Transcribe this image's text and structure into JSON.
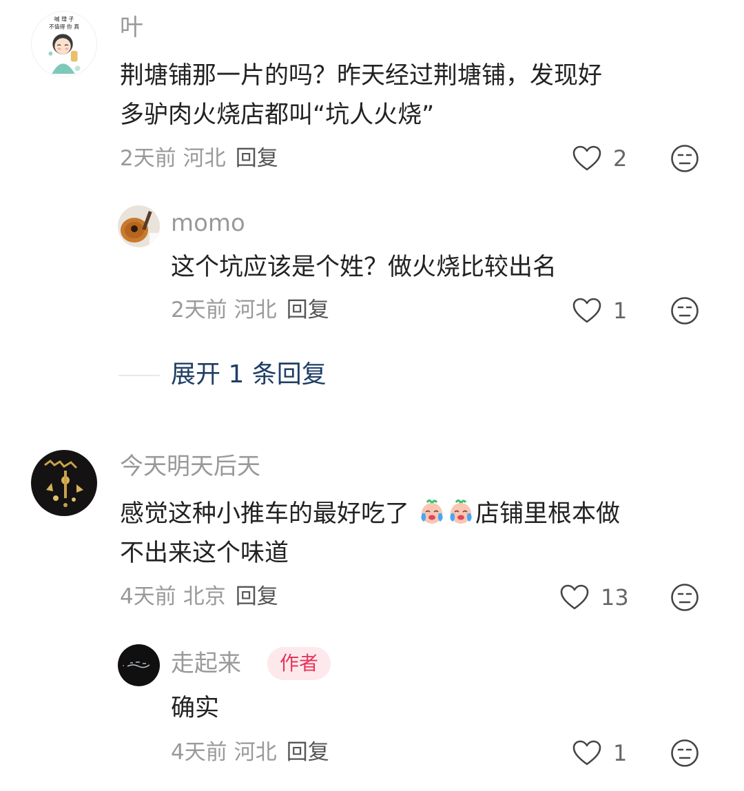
{
  "comments": [
    {
      "username": "叶",
      "avatar_icon": "cartoon-girl-avatar",
      "avatar_text": "...喊 理 不值得 你 真",
      "text": "荆塘铺那一片的吗？昨天经过荆塘铺，发现好多驴肉火烧店都叫“坑人火烧”",
      "text_lines": [
        "荆塘铺那一片的吗？昨天经过荆塘铺，发现好",
        "多驴肉火烧店都叫“坑人火烧”"
      ],
      "time": "2天前",
      "location": "河北",
      "reply_label": "回复",
      "likes": "2",
      "replies": [
        {
          "username": "momo",
          "avatar_icon": "guitar-avatar",
          "text": "这个坑应该是个姓？做火烧比较出名",
          "time": "2天前",
          "location": "河北",
          "reply_label": "回复",
          "likes": "1"
        }
      ],
      "expand_label": "展开 1 条回复"
    },
    {
      "username": "今天明天后天",
      "avatar_icon": "golden-ornament-avatar",
      "text_line1_before": "感觉这种小推车的最好吃了",
      "text_line1_after": "店铺里根本做",
      "text_line2": "不出来这个味道",
      "emojis": [
        "crying-laughing-emoji",
        "crying-laughing-emoji"
      ],
      "time": "4天前",
      "location": "北京",
      "reply_label": "回复",
      "likes": "13",
      "replies": [
        {
          "username": "走起来",
          "avatar_icon": "dark-sign-avatar",
          "badge": "作者",
          "text": "确实",
          "time": "4天前",
          "location": "河北",
          "reply_label": "回复",
          "likes": "1"
        }
      ]
    }
  ],
  "colors": {
    "username": "#999999",
    "text": "#222222",
    "expand_link": "#1f3e66",
    "author_badge_bg": "#fde9ec",
    "author_badge_text": "#e8345a"
  }
}
